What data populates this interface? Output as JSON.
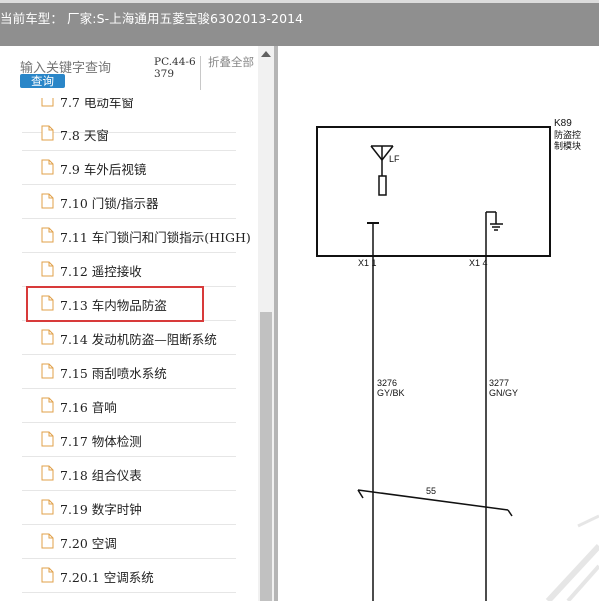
{
  "header": {
    "title": "当前车型：  厂家:S-上海通用五菱宝骏6302013-2014"
  },
  "sidebar": {
    "search_placeholder": "输入关键字查询",
    "search_button": "查询",
    "pc_label": "PC.44-6379",
    "collapse_all": "折叠全部",
    "items": [
      {
        "label": "7.7 电动车窗"
      },
      {
        "label": "7.8 天窗"
      },
      {
        "label": "7.9 车外后视镜"
      },
      {
        "label": "7.10 门锁/指示器"
      },
      {
        "label": "7.11 车门锁闩和门锁指示(HIGH)"
      },
      {
        "label": "7.12 遥控接收"
      },
      {
        "label": "7.13 车内物品防盗"
      },
      {
        "label": "7.14 发动机防盗—阻断系统"
      },
      {
        "label": "7.15 雨刮喷水系统"
      },
      {
        "label": "7.16 音响"
      },
      {
        "label": "7.17 物体检测"
      },
      {
        "label": "7.18 组合仪表"
      },
      {
        "label": "7.19 数字时钟"
      },
      {
        "label": "7.20 空调"
      },
      {
        "label": "7.20.1 空调系统"
      }
    ],
    "selected_index": 6
  },
  "diagram": {
    "module_code": "K89",
    "module_name_line1": "防盗控",
    "module_name_line2": "制模块",
    "antenna_label": "LF",
    "pin_left": "X1 1",
    "pin_right": "X1 4",
    "wire_left_num": "3276",
    "wire_left_color": "GY/BK",
    "wire_right_num": "3277",
    "wire_right_color": "GN/GY",
    "splice_label": "55"
  },
  "colors": {
    "header_bg": "#8f8f8f",
    "search_button_bg": "#2a86c8",
    "highlight": "#d83a3a",
    "file_icon": "#e0a04a"
  }
}
